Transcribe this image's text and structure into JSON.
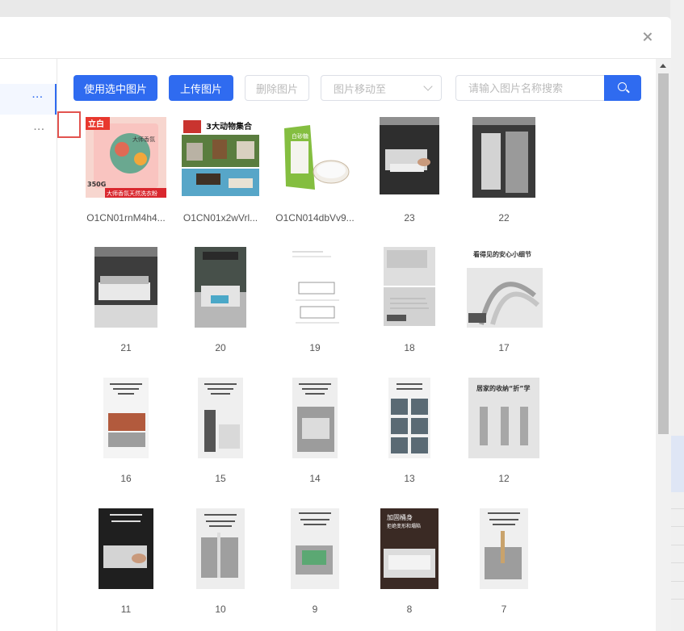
{
  "toolbar": {
    "use_selected_label": "使用选中图片",
    "upload_label": "上传图片",
    "delete_label": "删除图片",
    "move_to_placeholder": "图片移动至",
    "search_placeholder": "请输入图片名称搜索"
  },
  "sidebar": {
    "items": [
      {
        "more": "···"
      },
      {
        "more": "···"
      }
    ]
  },
  "images": [
    {
      "caption": "O1CN01rnM4h4...",
      "kind": "detergent",
      "text": [
        "立白",
        "大师香氛",
        "350G",
        "大师香氛天然洗衣粉"
      ]
    },
    {
      "caption": "O1CN01x2wVrl...",
      "kind": "animals",
      "text": [
        "3大动物集合"
      ]
    },
    {
      "caption": "O1CN014dbVv9...",
      "kind": "sugar",
      "text": [
        "白砂糖"
      ]
    },
    {
      "caption": "23",
      "kind": "photo-dark"
    },
    {
      "caption": "22",
      "kind": "photo-dark2"
    },
    {
      "caption": "21",
      "kind": "photo-light"
    },
    {
      "caption": "20",
      "kind": "photo-poster"
    },
    {
      "caption": "19",
      "kind": "diagram"
    },
    {
      "caption": "18",
      "kind": "two-panel"
    },
    {
      "caption": "17",
      "kind": "detail",
      "text": [
        "看得见的安心小细节"
      ]
    },
    {
      "caption": "16",
      "kind": "poster-color"
    },
    {
      "caption": "15",
      "kind": "poster-gray"
    },
    {
      "caption": "14",
      "kind": "poster-gray2"
    },
    {
      "caption": "13",
      "kind": "poster-grid"
    },
    {
      "caption": "12",
      "kind": "fold",
      "text": [
        "居家的收纳“折”学"
      ]
    },
    {
      "caption": "11",
      "kind": "poster-black"
    },
    {
      "caption": "10",
      "kind": "poster-mop"
    },
    {
      "caption": "9",
      "kind": "poster-carry"
    },
    {
      "caption": "8",
      "kind": "poster-thick",
      "text": [
        "加固桶身",
        "拒绝变形和塌陷"
      ]
    },
    {
      "caption": "7",
      "kind": "poster-mop2"
    }
  ],
  "colors": {
    "primary": "#2f6bf0",
    "highlight_border": "#e2534f"
  }
}
